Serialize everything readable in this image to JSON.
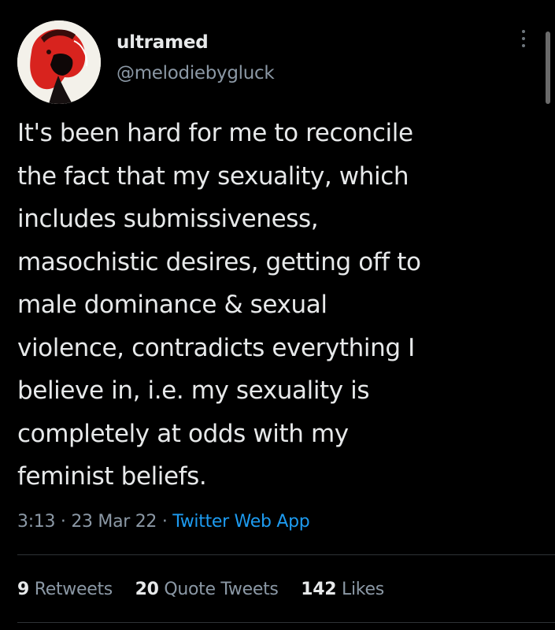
{
  "author": {
    "display_name": "ultramed",
    "handle": "@melodiebygluck"
  },
  "icons": {
    "more": "more-vertical-icon",
    "avatar": "profile-avatar"
  },
  "tweet": {
    "lines": [
      "It's been hard for me to reconcile",
      "the fact that my sexuality, which",
      "includes submissiveness,",
      "masochistic desires, getting off to",
      "male dominance & sexual",
      "violence, contradicts everything I",
      "believe in, i.e. my sexuality is",
      "completely at odds with my",
      "feminist beliefs."
    ],
    "time": "3:13",
    "date": "23 Mar 22",
    "separator": "·",
    "source": "Twitter Web App"
  },
  "stats": {
    "retweets": {
      "count": "9",
      "label": "Retweets"
    },
    "quotes": {
      "count": "20",
      "label": "Quote Tweets"
    },
    "likes": {
      "count": "142",
      "label": "Likes"
    }
  },
  "colors": {
    "background": "#000000",
    "text": "#e7e9ea",
    "muted": "#8b98a5",
    "link": "#1d9bf0",
    "divider": "#2f3336"
  }
}
